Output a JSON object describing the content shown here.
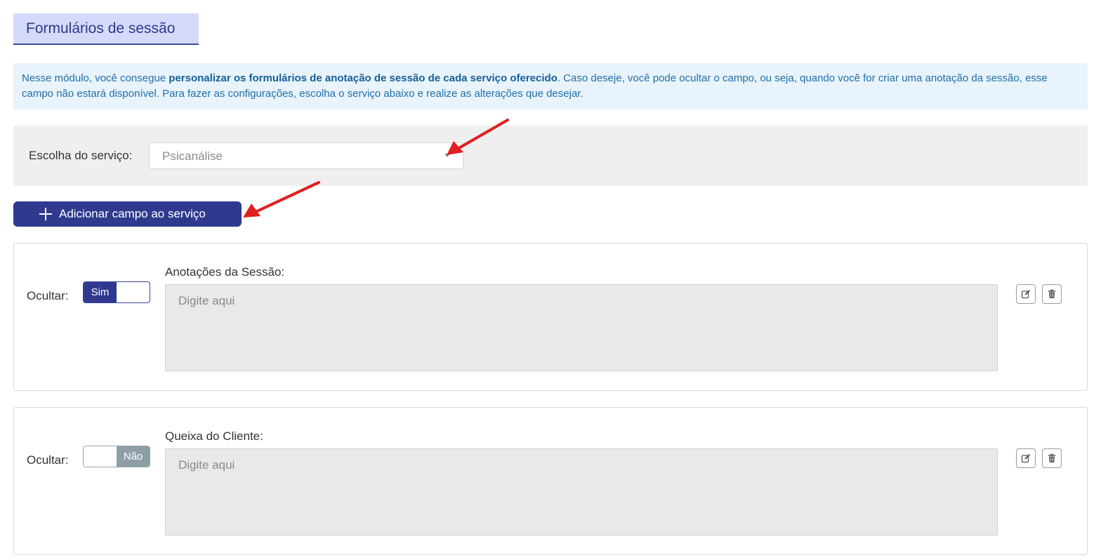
{
  "header": {
    "title": "Formulários de sessão"
  },
  "info": {
    "prefix": "Nesse módulo, você consegue ",
    "bold": "personalizar os formulários de anotação de sessão de cada serviço oferecido",
    "suffix": ". Caso deseje, você pode ocultar o campo, ou seja, quando você for criar uma anotação da sessão, esse campo não estará disponível. Para fazer as configurações, escolha o serviço abaixo e realize as alterações que desejar."
  },
  "service": {
    "label": "Escolha do serviço:",
    "selected": "Psicanálise"
  },
  "add_button": {
    "label": "Adicionar campo ao serviço"
  },
  "fields": [
    {
      "hide_label": "Ocultar:",
      "toggle_label": "Sim",
      "hidden": true,
      "label": "Anotações da Sessão:",
      "placeholder": "Digite aqui"
    },
    {
      "hide_label": "Ocultar:",
      "toggle_label": "Não",
      "hidden": false,
      "label": "Queixa do Cliente:",
      "placeholder": "Digite aqui"
    }
  ],
  "icons": {
    "add": "plus-icon",
    "edit": "edit-icon",
    "delete": "trash-icon",
    "select": "chevron-down-icon",
    "annotation": "arrow-icon"
  },
  "colors": {
    "primary": "#2f3a8f",
    "title_bg": "#d6dafa",
    "info_bg": "#e9f3fc",
    "info_text": "#1f6fa8",
    "panel_bg": "#eeefee",
    "toggle_off": "#8d9ea6",
    "annotation_arrow": "#e02020"
  }
}
